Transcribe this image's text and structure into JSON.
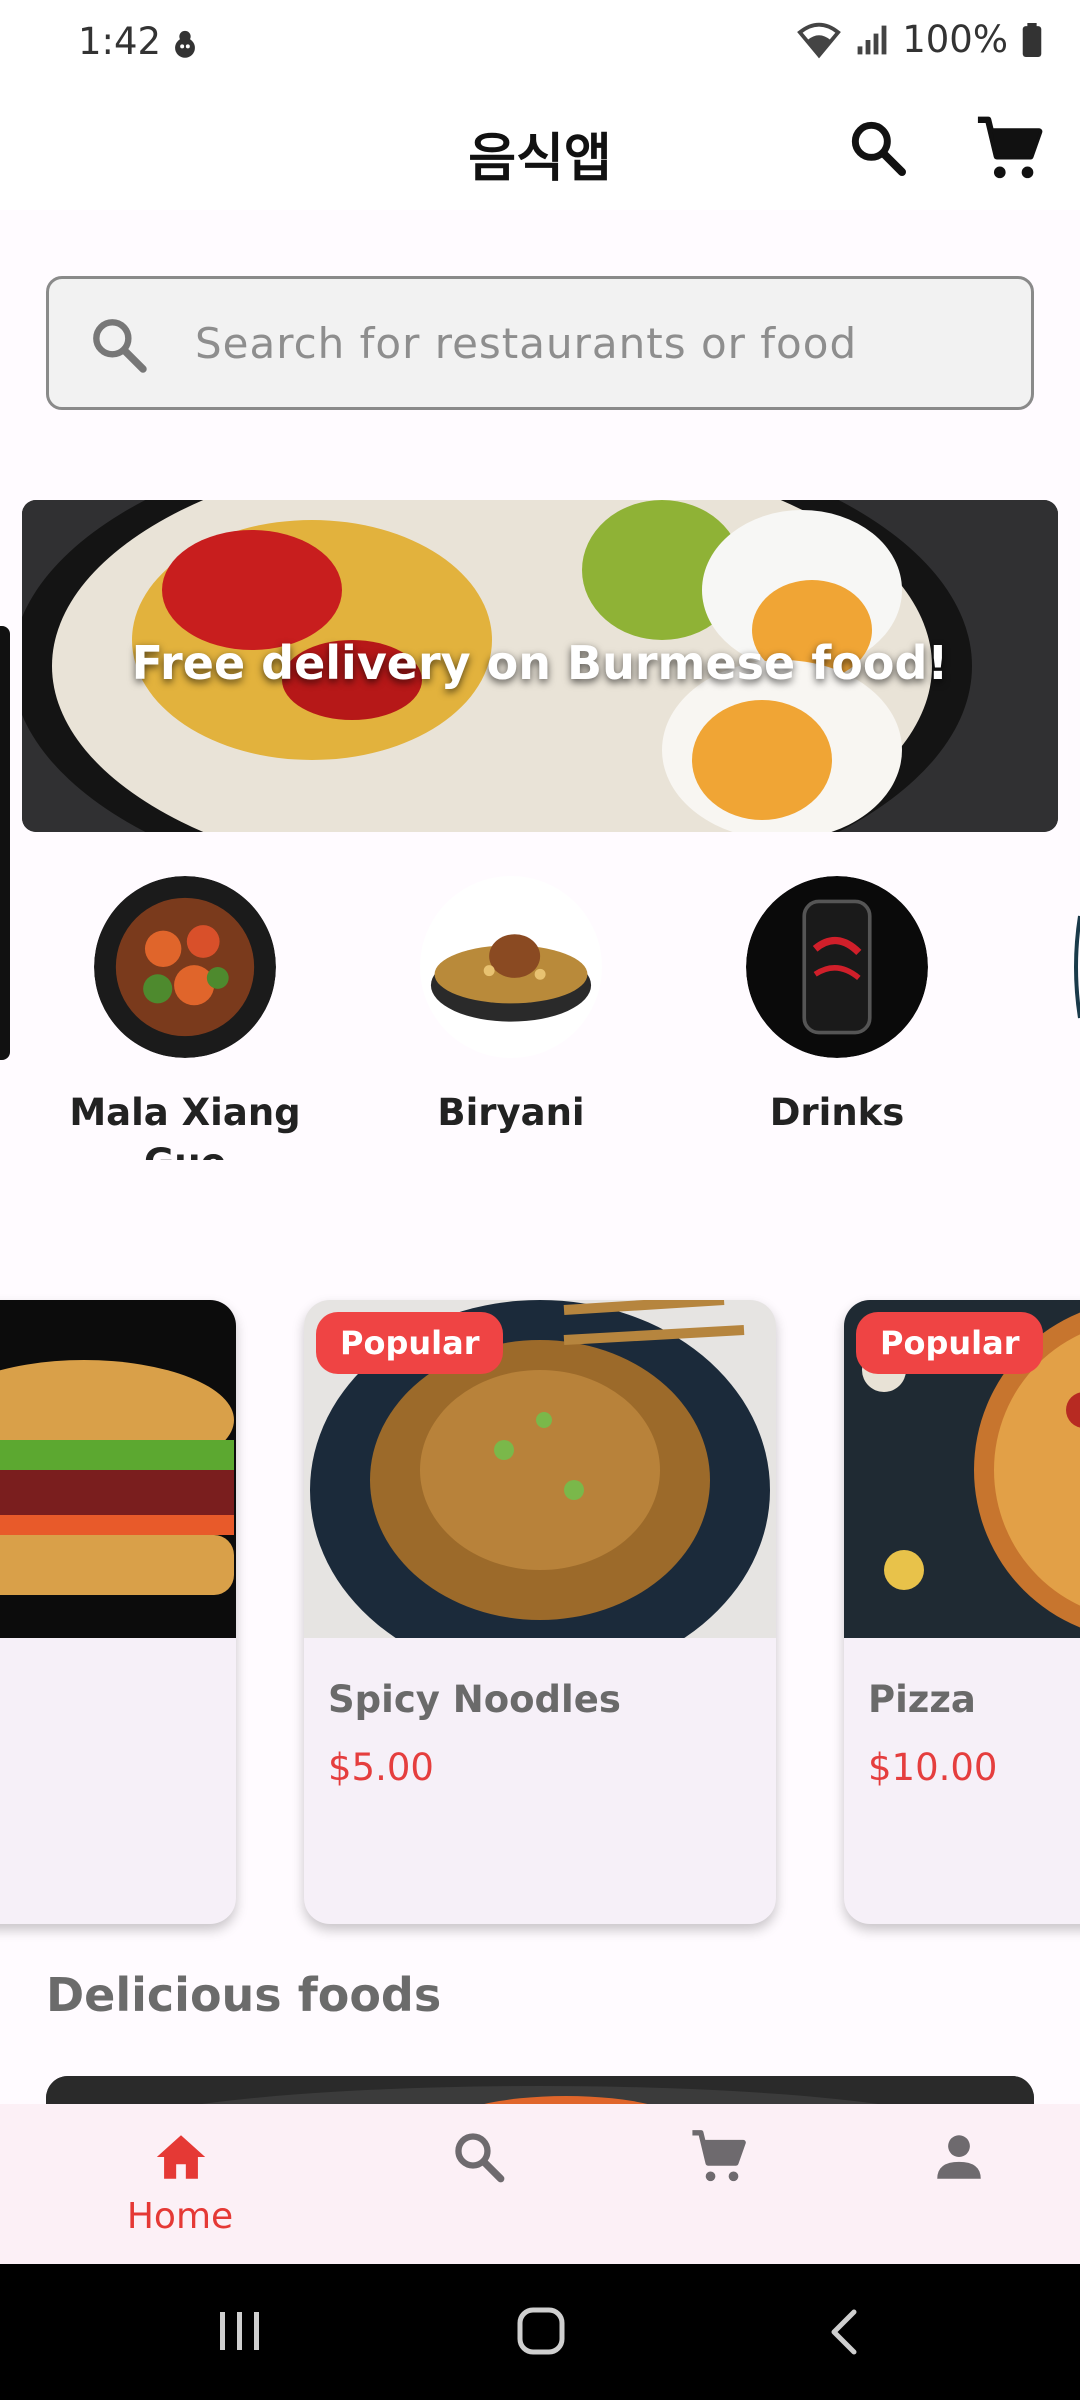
{
  "status_bar": {
    "time": "1:42",
    "battery": "100%"
  },
  "app_bar": {
    "title": "음식앱"
  },
  "search": {
    "placeholder": "Search for restaurants or food"
  },
  "banner": {
    "text": "Free delivery on Burmese food!"
  },
  "categories": [
    {
      "label": "Mala Xiang Guo"
    },
    {
      "label": "Biryani"
    },
    {
      "label": "Drinks"
    }
  ],
  "food_cards": [
    {
      "name": "",
      "price": "",
      "badge": ""
    },
    {
      "name": "Spicy Noodles",
      "price": "$5.00",
      "badge": "Popular"
    },
    {
      "name": "Pizza",
      "price": "$10.00",
      "badge": "Popular"
    }
  ],
  "section": {
    "title": "Delicious foods"
  },
  "bottom_nav": {
    "items": [
      {
        "label": "Home",
        "icon": "home-icon",
        "active": true
      },
      {
        "label": "",
        "icon": "search-icon"
      },
      {
        "label": "",
        "icon": "cart-icon"
      },
      {
        "label": "",
        "icon": "person-icon"
      }
    ]
  },
  "colors": {
    "accent": "#e53935",
    "badge": "#ef4444",
    "price": "#e53e3e",
    "nav_bg": "#fcf0f6"
  }
}
